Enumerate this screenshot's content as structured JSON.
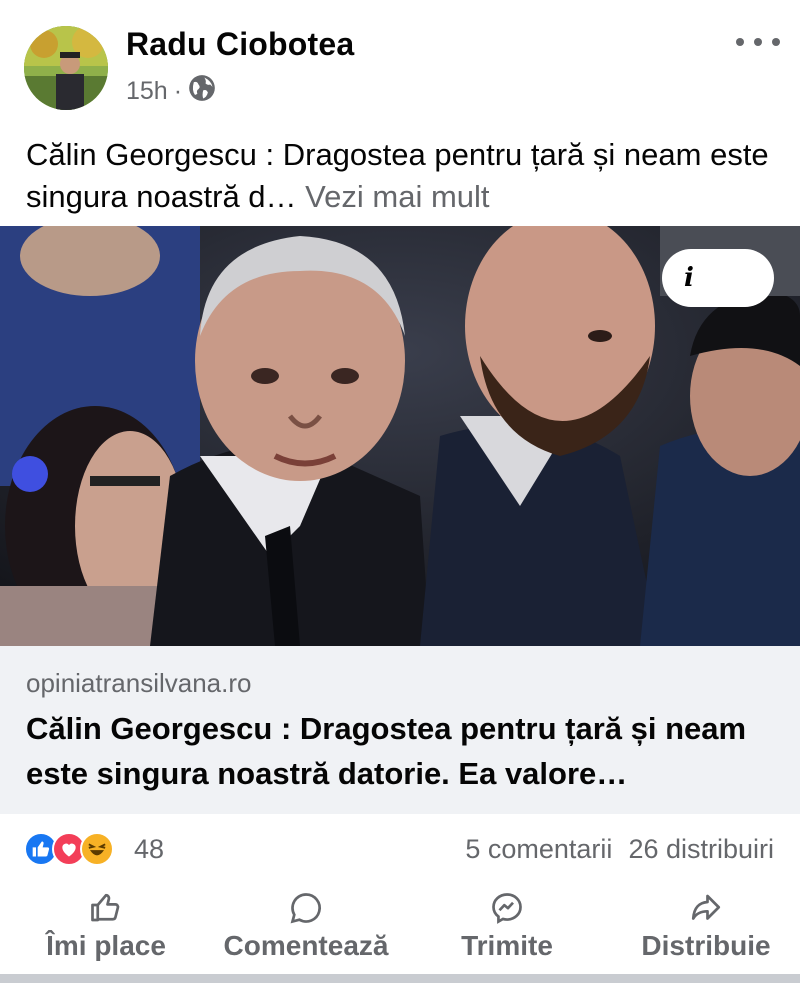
{
  "post": {
    "author": "Radu Ciobotea",
    "time": "15h",
    "separator": "·",
    "text": "Călin Georgescu : Dragostea pentru țară și neam este singura noastră d…",
    "see_more": "Vezi mai mult",
    "info_label": "i"
  },
  "link": {
    "domain": "opiniatransilvana.ro",
    "title": "Călin Georgescu : Dragostea pentru țară și neam este singura noastră datorie. Ea valore…"
  },
  "stats": {
    "reactions_count": "48",
    "comments": "5 comentarii",
    "shares": "26 distribuiri"
  },
  "actions": {
    "like": "Îmi place",
    "comment": "Comentează",
    "send": "Trimite",
    "share": "Distribuie"
  },
  "icons": {
    "globe": "globe-icon",
    "more": "more-options-icon",
    "like": "thumbs-up-icon",
    "comment": "comment-bubble-icon",
    "send": "messenger-icon",
    "share": "share-arrow-icon"
  },
  "colors": {
    "text": "#050505",
    "secondary": "#65676b",
    "link_bg": "#f0f2f5",
    "like_blue": "#1877f2",
    "love_red": "#f33e58",
    "haha_yellow": "#f7b125"
  }
}
